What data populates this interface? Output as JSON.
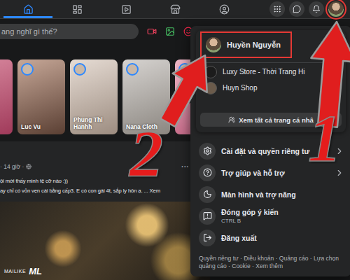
{
  "topbar": {
    "nav": [
      {
        "selected": true
      },
      {
        "selected": false
      },
      {
        "selected": false
      },
      {
        "selected": false
      },
      {
        "selected": false
      }
    ],
    "account": {
      "highlighted": true
    }
  },
  "composer": {
    "placeholder": "ang nghĩ gì thế?"
  },
  "stories": [
    {},
    {
      "name": "Luc Vu"
    },
    {
      "name": "Phung Thi Hanhh"
    },
    {
      "name": "Nana Cloth"
    },
    {}
  ],
  "post": {
    "meta": "· 14 giờ ·",
    "more": "···",
    "lines": [
      "ội mới thấy mình tệ cỡ nào :))",
      "ay chỉ có vỏn vẹn cái bằng cấp3. E có con gái 4t, sắp ly hôn ạ. ... Xem"
    ]
  },
  "menu": {
    "profile": {
      "name": "Huyền Nguyễn",
      "highlighted": true
    },
    "pages": [
      {
        "name": "Luxy Store - Thời Trang Hi"
      },
      {
        "name": "Huyn Shop"
      }
    ],
    "see_all": "Xem tất cả trang cá nhâ",
    "items": [
      {
        "label": "Cài đặt và quyền riêng tư",
        "has_submenu": true
      },
      {
        "label": "Trợ giúp và hỗ trợ",
        "has_submenu": true
      },
      {
        "label": "Màn hình và trợ năng",
        "has_submenu": false
      },
      {
        "label": "Đóng góp ý kiến",
        "shortcut": "CTRL B",
        "has_submenu": false
      },
      {
        "label": "Đăng xuất",
        "has_submenu": false
      }
    ],
    "footer": "Quyền riêng tư · Điều khoản · Quảng cáo · Lựa chọn quảng cáo · Cookie · Xem thêm"
  },
  "annotations": [
    {
      "label": "1"
    },
    {
      "label": "2"
    }
  ],
  "watermark": {
    "text": "MAILIKE",
    "logo": "ML"
  }
}
